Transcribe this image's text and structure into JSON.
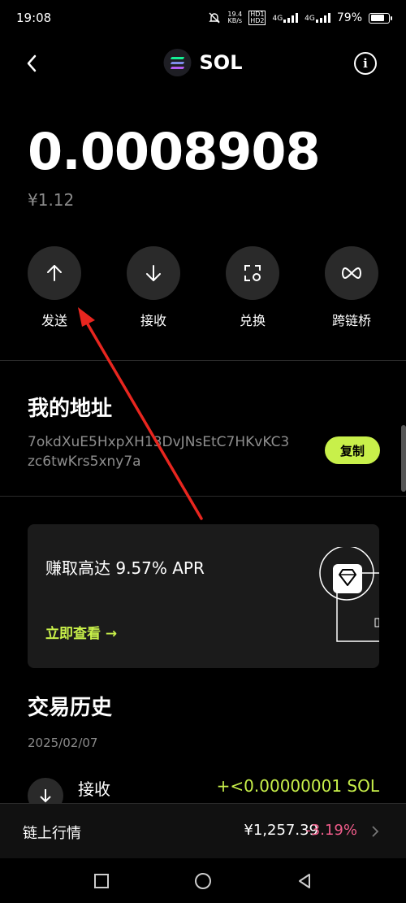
{
  "status": {
    "time": "19:08",
    "speed_top": "19.4",
    "speed_bottom": "KB/s",
    "hd1": "HD1",
    "hd2": "HD2",
    "net1": "4G",
    "net2": "4G",
    "battery": "79%",
    "battery_level": 0.79
  },
  "header": {
    "title": "SOL",
    "back_icon": "chevron-left-icon",
    "info_icon": "info-icon"
  },
  "balance": {
    "amount": "0.0008908",
    "fiat": "¥1.12"
  },
  "actions": [
    {
      "label": "发送",
      "icon": "arrow-up-icon"
    },
    {
      "label": "接收",
      "icon": "arrow-down-icon"
    },
    {
      "label": "兑换",
      "icon": "swap-icon"
    },
    {
      "label": "跨链桥",
      "icon": "bridge-icon"
    }
  ],
  "address": {
    "title": "我的地址",
    "value": "7okdXuE5HxpXH13DvJNsEtC7HKvKC3zc6twKrs5xny7a",
    "copy_label": "复制"
  },
  "earn": {
    "text": "赚取高达 9.57% APR",
    "link": "立即查看 →"
  },
  "history": {
    "title": "交易历史",
    "date": "2025/02/07",
    "rows": [
      {
        "label": "接收",
        "amount": "+<0.00000001 SOL"
      }
    ]
  },
  "market": {
    "label": "链上行情",
    "price": "¥1,257.39",
    "change": "-3.19%"
  },
  "colors": {
    "accent": "#c8f04a",
    "negative": "#f05c8a",
    "annotation": "#e8261f"
  }
}
